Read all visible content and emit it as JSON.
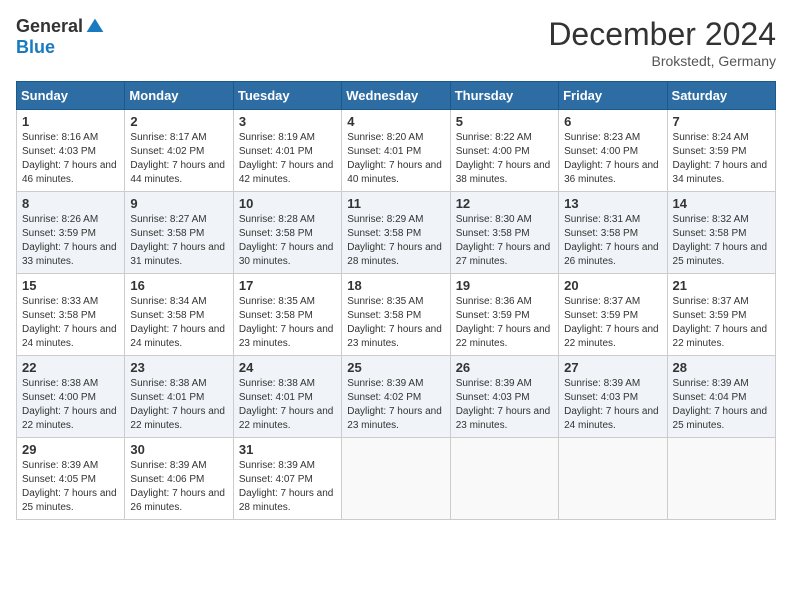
{
  "header": {
    "logo_general": "General",
    "logo_blue": "Blue",
    "month_year": "December 2024",
    "location": "Brokstedt, Germany"
  },
  "weekdays": [
    "Sunday",
    "Monday",
    "Tuesday",
    "Wednesday",
    "Thursday",
    "Friday",
    "Saturday"
  ],
  "weeks": [
    [
      {
        "day": "1",
        "sunrise": "Sunrise: 8:16 AM",
        "sunset": "Sunset: 4:03 PM",
        "daylight": "Daylight: 7 hours and 46 minutes."
      },
      {
        "day": "2",
        "sunrise": "Sunrise: 8:17 AM",
        "sunset": "Sunset: 4:02 PM",
        "daylight": "Daylight: 7 hours and 44 minutes."
      },
      {
        "day": "3",
        "sunrise": "Sunrise: 8:19 AM",
        "sunset": "Sunset: 4:01 PM",
        "daylight": "Daylight: 7 hours and 42 minutes."
      },
      {
        "day": "4",
        "sunrise": "Sunrise: 8:20 AM",
        "sunset": "Sunset: 4:01 PM",
        "daylight": "Daylight: 7 hours and 40 minutes."
      },
      {
        "day": "5",
        "sunrise": "Sunrise: 8:22 AM",
        "sunset": "Sunset: 4:00 PM",
        "daylight": "Daylight: 7 hours and 38 minutes."
      },
      {
        "day": "6",
        "sunrise": "Sunrise: 8:23 AM",
        "sunset": "Sunset: 4:00 PM",
        "daylight": "Daylight: 7 hours and 36 minutes."
      },
      {
        "day": "7",
        "sunrise": "Sunrise: 8:24 AM",
        "sunset": "Sunset: 3:59 PM",
        "daylight": "Daylight: 7 hours and 34 minutes."
      }
    ],
    [
      {
        "day": "8",
        "sunrise": "Sunrise: 8:26 AM",
        "sunset": "Sunset: 3:59 PM",
        "daylight": "Daylight: 7 hours and 33 minutes."
      },
      {
        "day": "9",
        "sunrise": "Sunrise: 8:27 AM",
        "sunset": "Sunset: 3:58 PM",
        "daylight": "Daylight: 7 hours and 31 minutes."
      },
      {
        "day": "10",
        "sunrise": "Sunrise: 8:28 AM",
        "sunset": "Sunset: 3:58 PM",
        "daylight": "Daylight: 7 hours and 30 minutes."
      },
      {
        "day": "11",
        "sunrise": "Sunrise: 8:29 AM",
        "sunset": "Sunset: 3:58 PM",
        "daylight": "Daylight: 7 hours and 28 minutes."
      },
      {
        "day": "12",
        "sunrise": "Sunrise: 8:30 AM",
        "sunset": "Sunset: 3:58 PM",
        "daylight": "Daylight: 7 hours and 27 minutes."
      },
      {
        "day": "13",
        "sunrise": "Sunrise: 8:31 AM",
        "sunset": "Sunset: 3:58 PM",
        "daylight": "Daylight: 7 hours and 26 minutes."
      },
      {
        "day": "14",
        "sunrise": "Sunrise: 8:32 AM",
        "sunset": "Sunset: 3:58 PM",
        "daylight": "Daylight: 7 hours and 25 minutes."
      }
    ],
    [
      {
        "day": "15",
        "sunrise": "Sunrise: 8:33 AM",
        "sunset": "Sunset: 3:58 PM",
        "daylight": "Daylight: 7 hours and 24 minutes."
      },
      {
        "day": "16",
        "sunrise": "Sunrise: 8:34 AM",
        "sunset": "Sunset: 3:58 PM",
        "daylight": "Daylight: 7 hours and 24 minutes."
      },
      {
        "day": "17",
        "sunrise": "Sunrise: 8:35 AM",
        "sunset": "Sunset: 3:58 PM",
        "daylight": "Daylight: 7 hours and 23 minutes."
      },
      {
        "day": "18",
        "sunrise": "Sunrise: 8:35 AM",
        "sunset": "Sunset: 3:58 PM",
        "daylight": "Daylight: 7 hours and 23 minutes."
      },
      {
        "day": "19",
        "sunrise": "Sunrise: 8:36 AM",
        "sunset": "Sunset: 3:59 PM",
        "daylight": "Daylight: 7 hours and 22 minutes."
      },
      {
        "day": "20",
        "sunrise": "Sunrise: 8:37 AM",
        "sunset": "Sunset: 3:59 PM",
        "daylight": "Daylight: 7 hours and 22 minutes."
      },
      {
        "day": "21",
        "sunrise": "Sunrise: 8:37 AM",
        "sunset": "Sunset: 3:59 PM",
        "daylight": "Daylight: 7 hours and 22 minutes."
      }
    ],
    [
      {
        "day": "22",
        "sunrise": "Sunrise: 8:38 AM",
        "sunset": "Sunset: 4:00 PM",
        "daylight": "Daylight: 7 hours and 22 minutes."
      },
      {
        "day": "23",
        "sunrise": "Sunrise: 8:38 AM",
        "sunset": "Sunset: 4:01 PM",
        "daylight": "Daylight: 7 hours and 22 minutes."
      },
      {
        "day": "24",
        "sunrise": "Sunrise: 8:38 AM",
        "sunset": "Sunset: 4:01 PM",
        "daylight": "Daylight: 7 hours and 22 minutes."
      },
      {
        "day": "25",
        "sunrise": "Sunrise: 8:39 AM",
        "sunset": "Sunset: 4:02 PM",
        "daylight": "Daylight: 7 hours and 23 minutes."
      },
      {
        "day": "26",
        "sunrise": "Sunrise: 8:39 AM",
        "sunset": "Sunset: 4:03 PM",
        "daylight": "Daylight: 7 hours and 23 minutes."
      },
      {
        "day": "27",
        "sunrise": "Sunrise: 8:39 AM",
        "sunset": "Sunset: 4:03 PM",
        "daylight": "Daylight: 7 hours and 24 minutes."
      },
      {
        "day": "28",
        "sunrise": "Sunrise: 8:39 AM",
        "sunset": "Sunset: 4:04 PM",
        "daylight": "Daylight: 7 hours and 25 minutes."
      }
    ],
    [
      {
        "day": "29",
        "sunrise": "Sunrise: 8:39 AM",
        "sunset": "Sunset: 4:05 PM",
        "daylight": "Daylight: 7 hours and 25 minutes."
      },
      {
        "day": "30",
        "sunrise": "Sunrise: 8:39 AM",
        "sunset": "Sunset: 4:06 PM",
        "daylight": "Daylight: 7 hours and 26 minutes."
      },
      {
        "day": "31",
        "sunrise": "Sunrise: 8:39 AM",
        "sunset": "Sunset: 4:07 PM",
        "daylight": "Daylight: 7 hours and 28 minutes."
      },
      null,
      null,
      null,
      null
    ]
  ]
}
